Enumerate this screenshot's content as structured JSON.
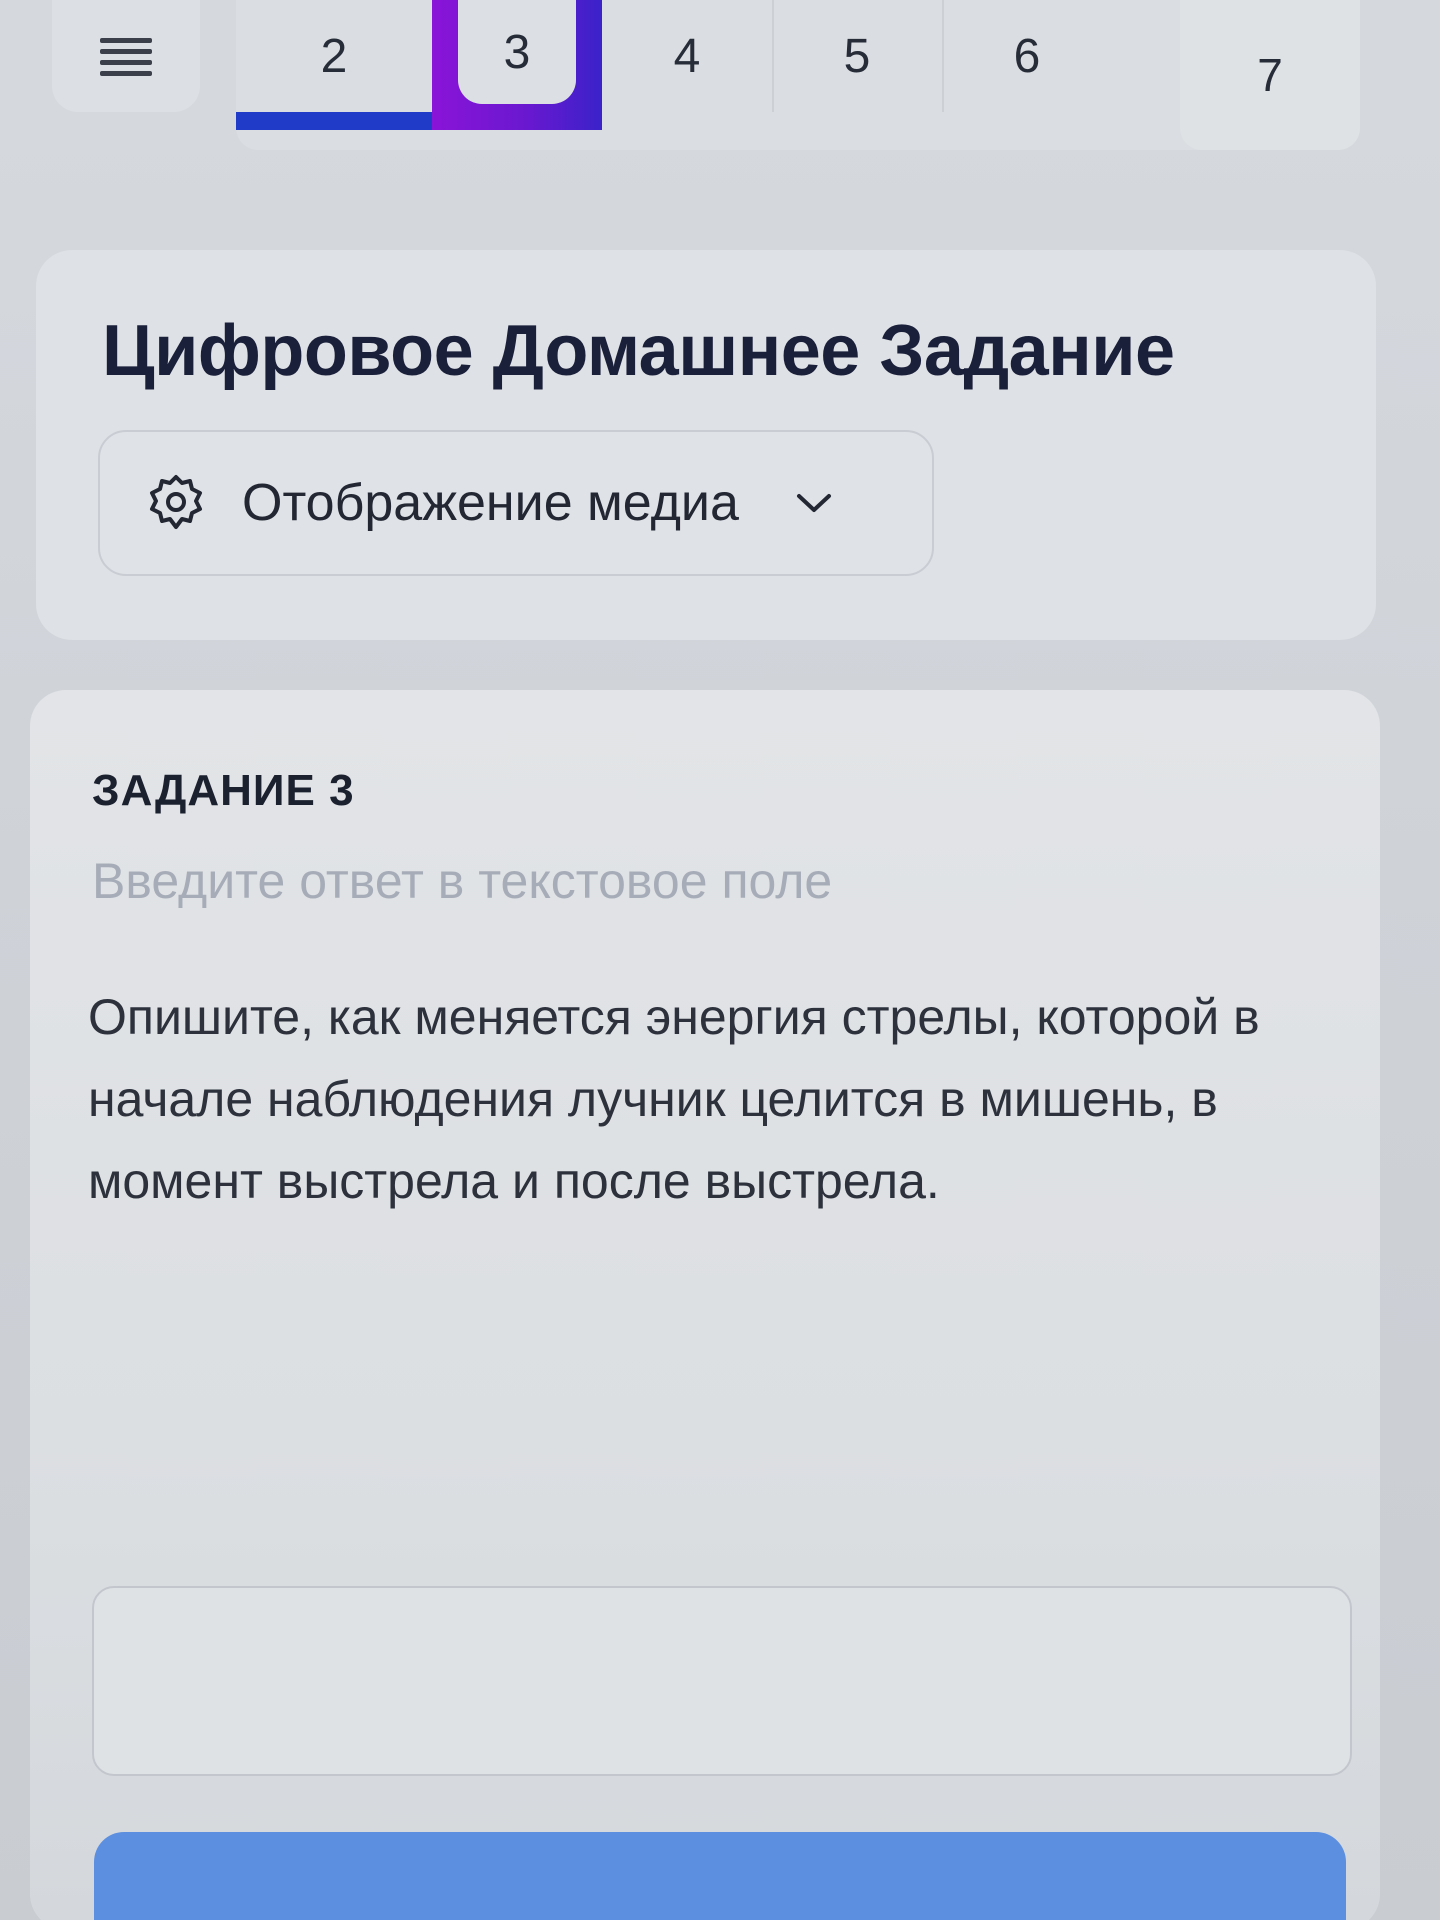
{
  "nav": {
    "menu_icon": "hamburger-menu-icon",
    "tabs": [
      "2",
      "3",
      "4",
      "5",
      "6",
      "7"
    ],
    "active_tab": "3",
    "colors": {
      "completed_underline": "#1f3bc7",
      "active_gradient_start": "#8a14d8",
      "active_gradient_end": "#3a22c9"
    }
  },
  "header": {
    "title": "Цифровое Домашнее Задание",
    "media_dropdown": {
      "icon": "gear-icon",
      "label": "Отображение медиа",
      "chevron": "chevron-down-icon"
    }
  },
  "task": {
    "label": "ЗАДАНИЕ 3",
    "hint": "Введите ответ в текстовое поле",
    "question": "Опишите, как меняется энергия стрелы, которой в начале наблюдения лучник целится в мишень, в момент выстрела и после выстрела.",
    "answer_value": "",
    "answer_placeholder": ""
  },
  "submit": {
    "color": "#5c8fe0"
  }
}
